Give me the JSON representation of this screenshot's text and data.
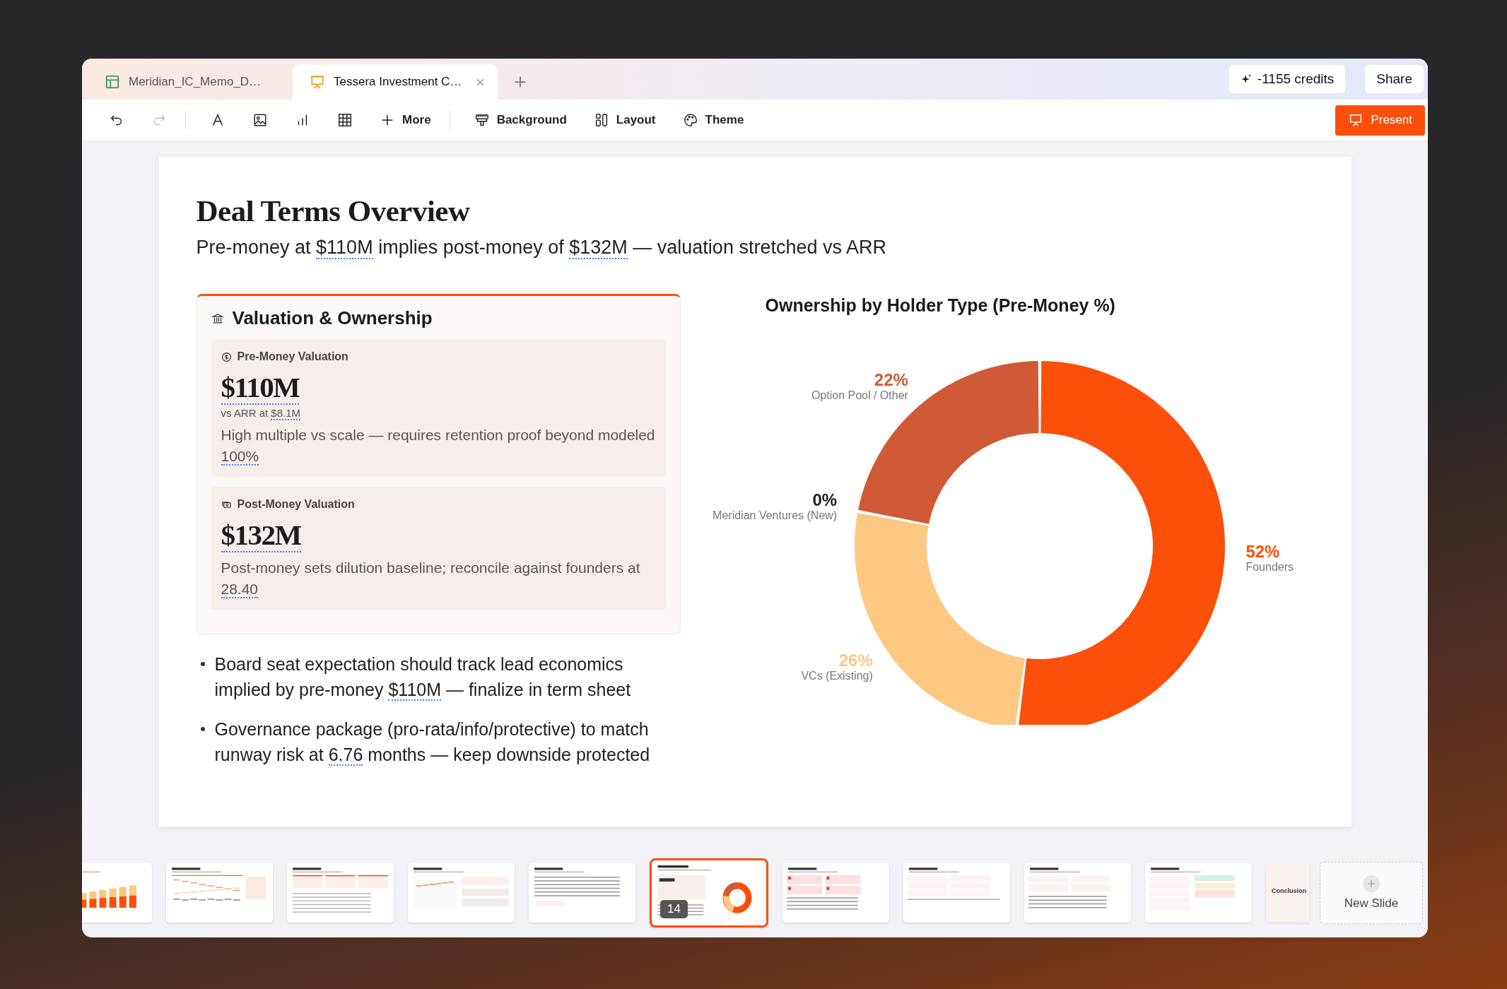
{
  "tabs": [
    {
      "kind": "sheet",
      "label": "Meridian_IC_Memo_D…",
      "selected": false,
      "closable": false
    },
    {
      "kind": "slides",
      "label": "Tessera Investment C…",
      "selected": true,
      "closable": true
    }
  ],
  "credits": "-1155 credits",
  "share": "Share",
  "toolbar": [
    {
      "kind": "undo",
      "disabled": false
    },
    {
      "kind": "redo",
      "disabled": true
    },
    {
      "kind": "divider"
    },
    {
      "kind": "text",
      "disabled": false
    },
    {
      "kind": "image",
      "disabled": false
    },
    {
      "kind": "chart",
      "disabled": false
    },
    {
      "kind": "table",
      "disabled": false
    },
    {
      "kind": "more",
      "label": "More",
      "disabled": false
    },
    {
      "kind": "divider"
    },
    {
      "kind": "background",
      "label": "Background",
      "disabled": false
    },
    {
      "kind": "layout",
      "label": "Layout",
      "disabled": false
    },
    {
      "kind": "theme",
      "label": "Theme",
      "disabled": false
    }
  ],
  "present": "Present",
  "slide": {
    "title": "Deal Terms Overview",
    "subtitle": [
      {
        "text": "Pre-money at ",
        "dotted": false
      },
      {
        "text": "$110M",
        "dotted": true
      },
      {
        "text": " implies post-money of ",
        "dotted": false
      },
      {
        "text": "$132M",
        "dotted": true
      },
      {
        "text": " — valuation stretched vs ARR",
        "dotted": false
      }
    ],
    "card": {
      "title": "Valuation & Ownership",
      "metrics": [
        {
          "kind": "pre",
          "label": "Pre-Money Valuation",
          "value": "$110M",
          "value_dotted": true,
          "note": [
            {
              "text": "vs ARR at ",
              "dotted": false
            },
            {
              "text": "$8.1M",
              "dotted": true
            }
          ],
          "description": [
            {
              "text": "High multiple vs scale — requires retention proof beyond modeled ",
              "dotted": false
            },
            {
              "text": "100%",
              "dotted": true
            }
          ]
        },
        {
          "kind": "post",
          "label": "Post-Money Valuation",
          "value": "$132M",
          "value_dotted": true,
          "description": [
            {
              "text": "Post-money sets dilution baseline; reconcile against founders at ",
              "dotted": false
            },
            {
              "text": "28.40",
              "dotted": true
            }
          ]
        }
      ]
    },
    "bullets": [
      [
        {
          "text": "Board seat expectation should track lead economics implied by pre-money ",
          "dotted": false
        },
        {
          "text": "$110M",
          "dotted": true
        },
        {
          "text": " — finalize in term sheet",
          "dotted": false
        }
      ],
      [
        {
          "text": "Governance package (pro-rata/info/protective) to match runway risk at ",
          "dotted": false
        },
        {
          "text": "6.76",
          "dotted": true
        },
        {
          "text": " months — keep downside protected",
          "dotted": false
        }
      ]
    ],
    "chart": {
      "chart_data": {
        "type": "donut",
        "title": "Ownership by Holder Type (Pre-Money %)",
        "categories": [
          "Founders",
          "VCs (Existing)",
          "Meridian Ventures (New)",
          "Option Pool / Other"
        ],
        "values": [
          52,
          26,
          0,
          22
        ],
        "colors": [
          "#fc4f0a",
          "#fdc882",
          "#1c1c1c",
          "#cf5a35"
        ],
        "value_labels": [
          "52%",
          "26%",
          "0%",
          "22%"
        ]
      }
    }
  },
  "thumbnails": [
    {
      "kind": "bars",
      "selected": false
    },
    {
      "kind": "lines",
      "selected": false
    },
    {
      "kind": "cards",
      "selected": false
    },
    {
      "kind": "chart-table",
      "selected": false
    },
    {
      "kind": "text",
      "selected": false
    },
    {
      "kind": "donut",
      "selected": true,
      "badge": "14"
    },
    {
      "kind": "alerts",
      "selected": false
    },
    {
      "kind": "list",
      "selected": false
    },
    {
      "kind": "grid",
      "selected": false
    },
    {
      "kind": "tags",
      "selected": false
    },
    {
      "kind": "title",
      "selected": false,
      "title": "Conclusion"
    }
  ],
  "new_slide": "New Slide"
}
